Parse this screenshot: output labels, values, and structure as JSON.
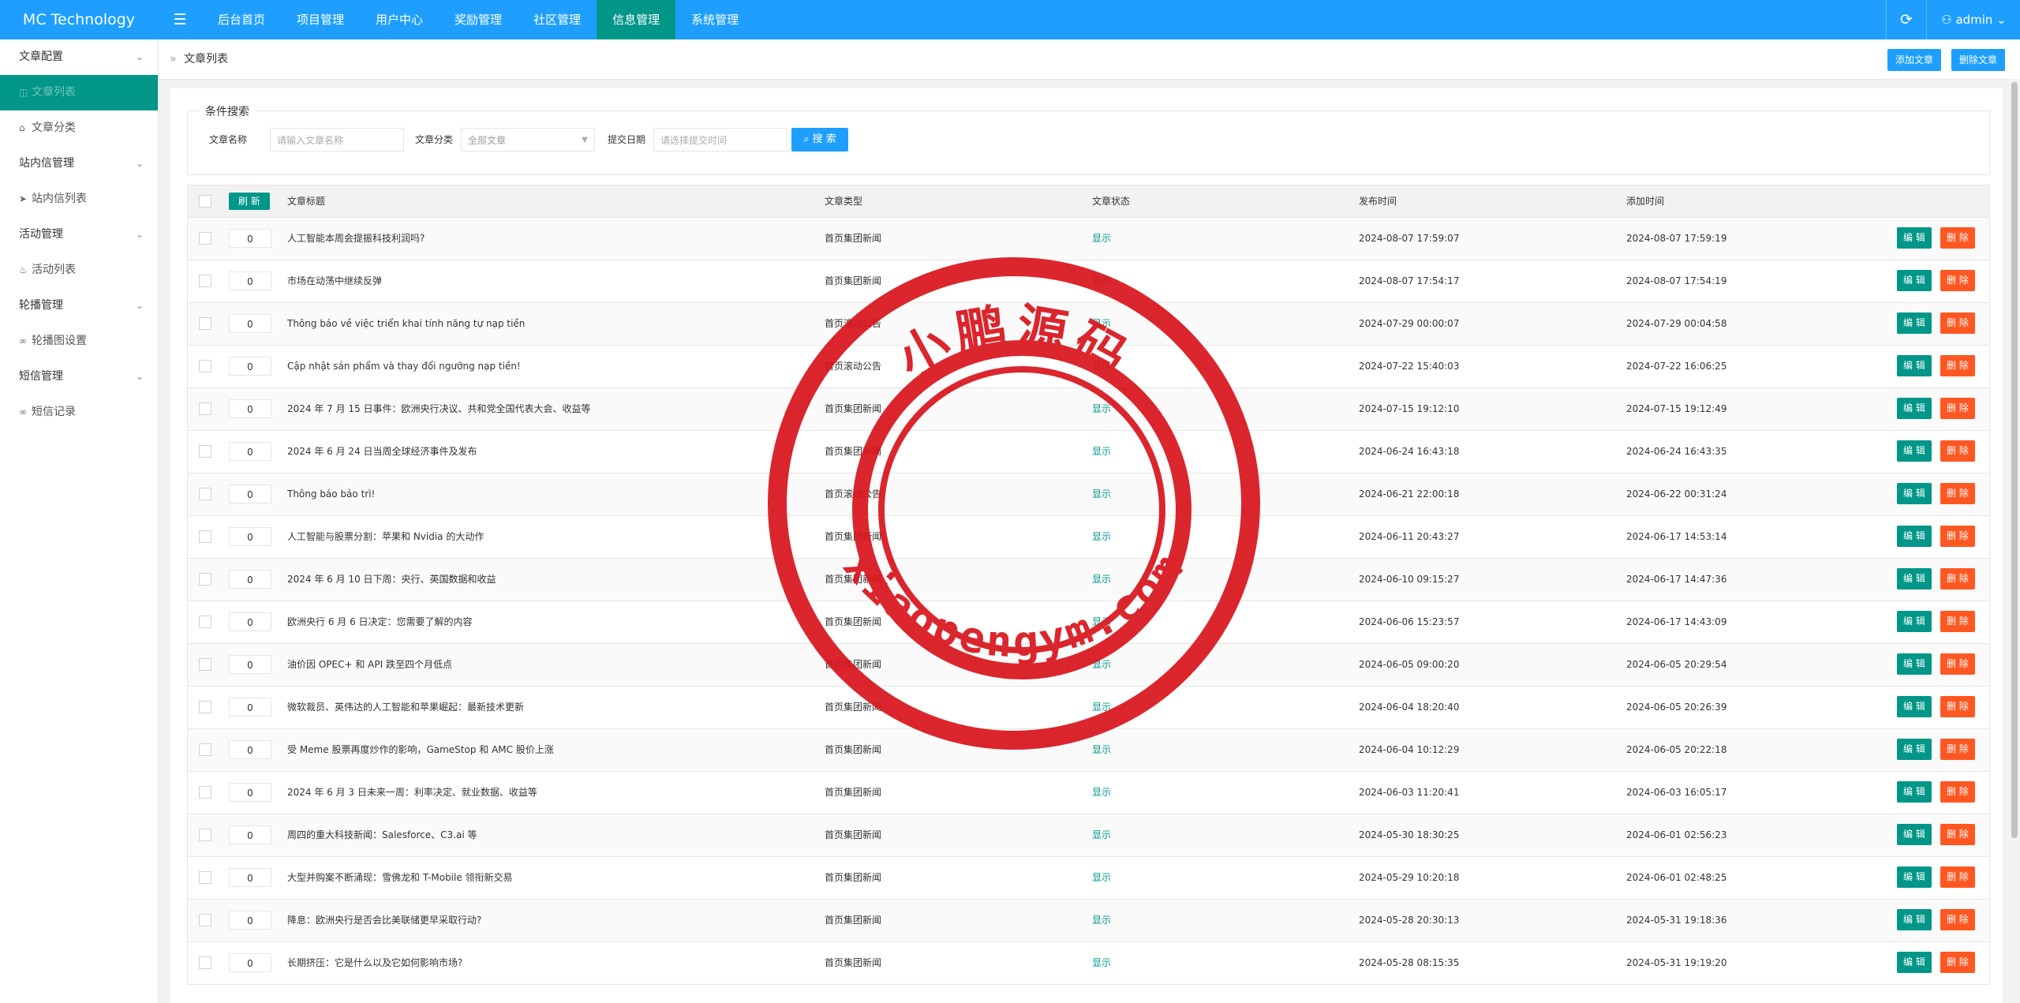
{
  "app": {
    "logo": "MC Technology",
    "menu_icon": "☰",
    "refresh_icon": "⟳",
    "user": "admin",
    "user_icon": "⚇",
    "user_caret": "⌄"
  },
  "nav": [
    {
      "label": "后台首页"
    },
    {
      "label": "项目管理"
    },
    {
      "label": "用户中心"
    },
    {
      "label": "奖励管理"
    },
    {
      "label": "社区管理"
    },
    {
      "label": "信息管理",
      "active": true
    },
    {
      "label": "系统管理"
    }
  ],
  "sidebar": [
    {
      "label": "文章配置",
      "type": "group"
    },
    {
      "label": "文章列表",
      "type": "sub",
      "icon": "◫",
      "active": true
    },
    {
      "label": "文章分类",
      "type": "sub",
      "icon": "⌂"
    },
    {
      "label": "站内信管理",
      "type": "group"
    },
    {
      "label": "站内信列表",
      "type": "sub",
      "icon": "➤"
    },
    {
      "label": "活动管理",
      "type": "group"
    },
    {
      "label": "活动列表",
      "type": "sub",
      "icon": "♨"
    },
    {
      "label": "轮播管理",
      "type": "group"
    },
    {
      "label": "轮播图设置",
      "type": "sub",
      "icon": "∞"
    },
    {
      "label": "短信管理",
      "type": "group"
    },
    {
      "label": "短信记录",
      "type": "sub",
      "icon": "∞"
    }
  ],
  "breadcrumb": {
    "sep": "»",
    "current": "文章列表"
  },
  "toolbar": {
    "add_label": "添加文章",
    "batch_delete_label": "删除文章"
  },
  "search": {
    "legend": "条件搜索",
    "name_label": "文章名称",
    "name_placeholder": "请输入文章名称",
    "type_label": "文章分类",
    "type_value": "全部文章",
    "date_label": "提交日期",
    "date_placeholder": "请选择提交时间",
    "button_label": "搜 索",
    "button_icon": "⌕"
  },
  "table": {
    "refresh_label": "刷 新",
    "headers": {
      "title": "文章标题",
      "type": "文章类型",
      "status": "文章状态",
      "published": "发布时间",
      "added": "添加时间"
    },
    "edit_label": "编 辑",
    "delete_label": "删 除",
    "rows": [
      {
        "sort": "0",
        "title": "人工智能本周会提振科技利润吗?",
        "type": "首页集团新闻",
        "status": "显示",
        "published": "2024-08-07 17:59:07",
        "added": "2024-08-07 17:59:19"
      },
      {
        "sort": "0",
        "title": "市场在动荡中继续反弹",
        "type": "首页集团新闻",
        "status": "显示",
        "published": "2024-08-07 17:54:17",
        "added": "2024-08-07 17:54:19"
      },
      {
        "sort": "0",
        "title": "Thông báo về việc triển khai tính năng tự nạp tiền",
        "type": "首页滚动公告",
        "status": "显示",
        "published": "2024-07-29 00:00:07",
        "added": "2024-07-29 00:04:58"
      },
      {
        "sort": "0",
        "title": "Cập nhật sản phẩm và thay đổi ngưỡng nạp tiền!",
        "type": "首页滚动公告",
        "status": "显示",
        "published": "2024-07-22 15:40:03",
        "added": "2024-07-22 16:06:25"
      },
      {
        "sort": "0",
        "title": "2024 年 7 月 15 日事件：欧洲央行决议、共和党全国代表大会、收益等",
        "type": "首页集团新闻",
        "status": "显示",
        "published": "2024-07-15 19:12:10",
        "added": "2024-07-15 19:12:49"
      },
      {
        "sort": "0",
        "title": "2024 年 6 月 24 日当周全球经济事件及发布",
        "type": "首页集团新闻",
        "status": "显示",
        "published": "2024-06-24 16:43:18",
        "added": "2024-06-24 16:43:35"
      },
      {
        "sort": "0",
        "title": "Thông báo bảo trì!",
        "type": "首页滚动公告",
        "status": "显示",
        "published": "2024-06-21 22:00:18",
        "added": "2024-06-22 00:31:24"
      },
      {
        "sort": "0",
        "title": "人工智能与股票分割：苹果和 Nvidia 的大动作",
        "type": "首页集团新闻",
        "status": "显示",
        "published": "2024-06-11 20:43:27",
        "added": "2024-06-17 14:53:14"
      },
      {
        "sort": "0",
        "title": "2024 年 6 月 10 日下周：央行、英国数据和收益",
        "type": "首页集团新闻",
        "status": "显示",
        "published": "2024-06-10 09:15:27",
        "added": "2024-06-17 14:47:36"
      },
      {
        "sort": "0",
        "title": "欧洲央行 6 月 6 日决定：您需要了解的内容",
        "type": "首页集团新闻",
        "status": "显示",
        "published": "2024-06-06 15:23:57",
        "added": "2024-06-17 14:43:09"
      },
      {
        "sort": "0",
        "title": "油价因 OPEC+ 和 API 跌至四个月低点",
        "type": "首页集团新闻",
        "status": "显示",
        "published": "2024-06-05 09:00:20",
        "added": "2024-06-05 20:29:54"
      },
      {
        "sort": "0",
        "title": "微软裁员、英伟达的人工智能和苹果崛起：最新技术更新",
        "type": "首页集团新闻",
        "status": "显示",
        "published": "2024-06-04 18:20:40",
        "added": "2024-06-05 20:26:39"
      },
      {
        "sort": "0",
        "title": "受 Meme 股票再度炒作的影响，GameStop 和 AMC 股价上涨",
        "type": "首页集团新闻",
        "status": "显示",
        "published": "2024-06-04 10:12:29",
        "added": "2024-06-05 20:22:18"
      },
      {
        "sort": "0",
        "title": "2024 年 6 月 3 日未来一周：利率决定、就业数据、收益等",
        "type": "首页集团新闻",
        "status": "显示",
        "published": "2024-06-03 11:20:41",
        "added": "2024-06-03 16:05:17"
      },
      {
        "sort": "0",
        "title": "周四的重大科技新闻：Salesforce、C3.ai 等",
        "type": "首页集团新闻",
        "status": "显示",
        "published": "2024-05-30 18:30:25",
        "added": "2024-06-01 02:56:23"
      },
      {
        "sort": "0",
        "title": "大型并购案不断涌现：雪佛龙和 T-Mobile 领衔新交易",
        "type": "首页集团新闻",
        "status": "显示",
        "published": "2024-05-29 10:20:18",
        "added": "2024-06-01 02:48:25"
      },
      {
        "sort": "0",
        "title": "降息：欧洲央行是否会比美联储更早采取行动?",
        "type": "首页集团新闻",
        "status": "显示",
        "published": "2024-05-28 20:30:13",
        "added": "2024-05-31 19:18:36"
      },
      {
        "sort": "0",
        "title": "长期挤压：它是什么以及它如何影响市场?",
        "type": "首页集团新闻",
        "status": "显示",
        "published": "2024-05-28 08:15:35",
        "added": "2024-05-31 19:19:20"
      }
    ]
  },
  "watermark": {
    "top_text": "小鹏源码",
    "bottom_text": "xiaopengym.com",
    "color": "#d9141c"
  },
  "colors": {
    "primary": "#1e9fff",
    "green": "#009688",
    "danger": "#ff5722"
  }
}
